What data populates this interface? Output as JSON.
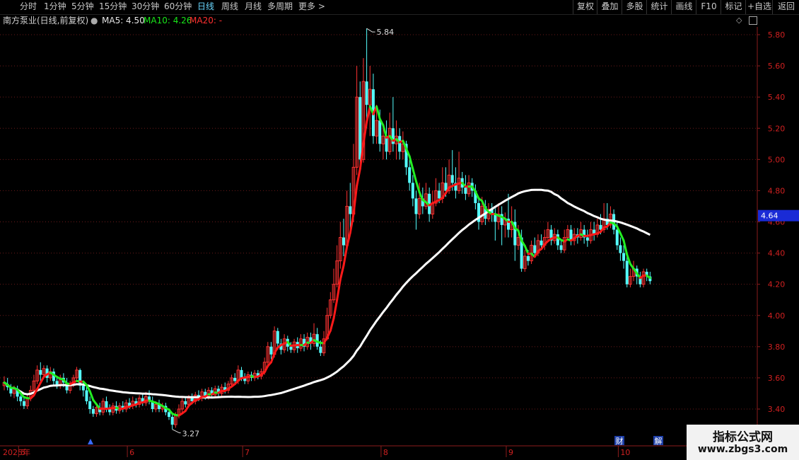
{
  "toolbar": {
    "periods": [
      {
        "label": "分时"
      },
      {
        "label": "1分钟"
      },
      {
        "label": "5分钟"
      },
      {
        "label": "15分钟"
      },
      {
        "label": "30分钟"
      },
      {
        "label": "60分钟"
      },
      {
        "label": "日线",
        "active": true
      },
      {
        "label": "周线"
      },
      {
        "label": "月线"
      },
      {
        "label": "多周期"
      },
      {
        "label": "更多 >"
      }
    ],
    "actions": [
      {
        "label": "复权"
      },
      {
        "label": "叠加"
      },
      {
        "label": "多股"
      },
      {
        "label": "统计"
      },
      {
        "label": "画线"
      },
      {
        "label": "F10"
      },
      {
        "label": "标记"
      },
      {
        "label": "+自选"
      },
      {
        "label": "返回"
      }
    ]
  },
  "info": {
    "stock": "南方泵业(日线,前复权)",
    "ma5_label": "MA5: 4.50",
    "ma10_label": "MA10: 4.26",
    "ma20_label": "MA20: -"
  },
  "chart_data": {
    "type": "candlestick",
    "ylim": [
      3.3,
      5.9
    ],
    "y_ticks": [
      "5.80",
      "5.60",
      "5.40",
      "5.20",
      "5.00",
      "4.80",
      "4.60",
      "4.40",
      "4.20",
      "4.00",
      "3.80",
      "3.60",
      "3.40"
    ],
    "x_labels": [
      {
        "label": "2025年",
        "i": 0
      },
      {
        "label": "5",
        "i": 5
      },
      {
        "label": "6",
        "i": 38
      },
      {
        "label": "7",
        "i": 73
      },
      {
        "label": "8",
        "i": 115
      },
      {
        "label": "9",
        "i": 153
      },
      {
        "label": "10",
        "i": 187
      },
      {
        "label": "11",
        "i": 215
      }
    ],
    "current_price": "4.64",
    "max_annotation": "5.84",
    "min_annotation": "3.27",
    "event_markers": [
      "财",
      "解"
    ],
    "candles": [
      [
        3.55,
        3.57,
        3.52,
        3.61
      ],
      [
        3.56,
        3.54,
        3.52,
        3.6
      ],
      [
        3.54,
        3.5,
        3.48,
        3.56
      ],
      [
        3.5,
        3.53,
        3.47,
        3.55
      ],
      [
        3.53,
        3.48,
        3.45,
        3.55
      ],
      [
        3.48,
        3.45,
        3.42,
        3.51
      ],
      [
        3.45,
        3.42,
        3.4,
        3.48
      ],
      [
        3.42,
        3.47,
        3.4,
        3.49
      ],
      [
        3.47,
        3.52,
        3.45,
        3.55
      ],
      [
        3.52,
        3.58,
        3.5,
        3.62
      ],
      [
        3.58,
        3.65,
        3.56,
        3.68
      ],
      [
        3.65,
        3.62,
        3.58,
        3.7
      ],
      [
        3.62,
        3.66,
        3.6,
        3.68
      ],
      [
        3.66,
        3.6,
        3.57,
        3.68
      ],
      [
        3.6,
        3.64,
        3.58,
        3.67
      ],
      [
        3.64,
        3.58,
        3.55,
        3.66
      ],
      [
        3.58,
        3.55,
        3.53,
        3.61
      ],
      [
        3.55,
        3.6,
        3.53,
        3.62
      ],
      [
        3.6,
        3.57,
        3.54,
        3.63
      ],
      [
        3.57,
        3.52,
        3.5,
        3.6
      ],
      [
        3.52,
        3.56,
        3.5,
        3.58
      ],
      [
        3.56,
        3.6,
        3.54,
        3.62
      ],
      [
        3.6,
        3.65,
        3.58,
        3.67
      ],
      [
        3.65,
        3.55,
        3.52,
        3.66
      ],
      [
        3.55,
        3.52,
        3.48,
        3.57
      ],
      [
        3.52,
        3.45,
        3.43,
        3.55
      ],
      [
        3.45,
        3.4,
        3.37,
        3.48
      ],
      [
        3.4,
        3.37,
        3.35,
        3.42
      ],
      [
        3.37,
        3.41,
        3.35,
        3.44
      ],
      [
        3.41,
        3.38,
        3.36,
        3.44
      ],
      [
        3.38,
        3.45,
        3.36,
        3.47
      ],
      [
        3.45,
        3.4,
        3.38,
        3.48
      ],
      [
        3.4,
        3.38,
        3.36,
        3.43
      ],
      [
        3.38,
        3.42,
        3.36,
        3.44
      ],
      [
        3.42,
        3.39,
        3.37,
        3.45
      ],
      [
        3.39,
        3.42,
        3.37,
        3.44
      ],
      [
        3.42,
        3.4,
        3.38,
        3.45
      ],
      [
        3.4,
        3.44,
        3.38,
        3.46
      ],
      [
        3.44,
        3.42,
        3.4,
        3.47
      ],
      [
        3.42,
        3.45,
        3.4,
        3.48
      ],
      [
        3.45,
        3.43,
        3.41,
        3.47
      ],
      [
        3.43,
        3.47,
        3.41,
        3.49
      ],
      [
        3.47,
        3.44,
        3.42,
        3.5
      ],
      [
        3.44,
        3.48,
        3.42,
        3.51
      ],
      [
        3.48,
        3.45,
        3.43,
        3.52
      ],
      [
        3.45,
        3.4,
        3.38,
        3.48
      ],
      [
        3.4,
        3.43,
        3.38,
        3.45
      ],
      [
        3.43,
        3.4,
        3.38,
        3.46
      ],
      [
        3.4,
        3.42,
        3.38,
        3.44
      ],
      [
        3.42,
        3.38,
        3.36,
        3.44
      ],
      [
        3.38,
        3.35,
        3.33,
        3.4
      ],
      [
        3.35,
        3.3,
        3.27,
        3.37
      ],
      [
        3.3,
        3.36,
        3.28,
        3.38
      ],
      [
        3.36,
        3.4,
        3.34,
        3.43
      ],
      [
        3.4,
        3.45,
        3.38,
        3.47
      ],
      [
        3.45,
        3.43,
        3.41,
        3.48
      ],
      [
        3.43,
        3.47,
        3.41,
        3.49
      ],
      [
        3.47,
        3.45,
        3.43,
        3.5
      ],
      [
        3.45,
        3.49,
        3.43,
        3.51
      ],
      [
        3.49,
        3.47,
        3.45,
        3.52
      ],
      [
        3.47,
        3.51,
        3.45,
        3.53
      ],
      [
        3.51,
        3.48,
        3.46,
        3.53
      ],
      [
        3.48,
        3.52,
        3.46,
        3.54
      ],
      [
        3.52,
        3.49,
        3.47,
        3.54
      ],
      [
        3.49,
        3.53,
        3.47,
        3.55
      ],
      [
        3.53,
        3.5,
        3.48,
        3.55
      ],
      [
        3.5,
        3.54,
        3.48,
        3.56
      ],
      [
        3.54,
        3.52,
        3.5,
        3.57
      ],
      [
        3.52,
        3.56,
        3.5,
        3.58
      ],
      [
        3.56,
        3.6,
        3.54,
        3.62
      ],
      [
        3.6,
        3.58,
        3.56,
        3.63
      ],
      [
        3.58,
        3.65,
        3.56,
        3.68
      ],
      [
        3.65,
        3.6,
        3.58,
        3.67
      ],
      [
        3.6,
        3.58,
        3.56,
        3.63
      ],
      [
        3.58,
        3.62,
        3.56,
        3.64
      ],
      [
        3.62,
        3.6,
        3.58,
        3.64
      ],
      [
        3.6,
        3.63,
        3.58,
        3.65
      ],
      [
        3.63,
        3.61,
        3.59,
        3.65
      ],
      [
        3.61,
        3.64,
        3.59,
        3.66
      ],
      [
        3.64,
        3.7,
        3.62,
        3.73
      ],
      [
        3.7,
        3.8,
        3.68,
        3.83
      ],
      [
        3.8,
        3.75,
        3.72,
        3.83
      ],
      [
        3.75,
        3.9,
        3.73,
        3.93
      ],
      [
        3.9,
        3.82,
        3.78,
        3.92
      ],
      [
        3.82,
        3.78,
        3.75,
        3.85
      ],
      [
        3.78,
        3.85,
        3.76,
        3.88
      ],
      [
        3.85,
        3.8,
        3.77,
        3.87
      ],
      [
        3.8,
        3.78,
        3.76,
        3.83
      ],
      [
        3.78,
        3.83,
        3.76,
        3.85
      ],
      [
        3.83,
        3.79,
        3.76,
        3.86
      ],
      [
        3.79,
        3.85,
        3.77,
        3.88
      ],
      [
        3.85,
        3.8,
        3.77,
        3.88
      ],
      [
        3.8,
        3.86,
        3.78,
        3.89
      ],
      [
        3.86,
        3.82,
        3.78,
        3.89
      ],
      [
        3.82,
        3.88,
        3.8,
        3.95
      ],
      [
        3.88,
        3.8,
        3.78,
        3.92
      ],
      [
        3.8,
        3.76,
        3.74,
        3.84
      ],
      [
        3.76,
        3.85,
        3.74,
        3.9
      ],
      [
        3.85,
        4.0,
        3.84,
        4.05
      ],
      [
        4.0,
        4.1,
        3.98,
        4.15
      ],
      [
        4.1,
        4.2,
        4.08,
        4.3
      ],
      [
        4.2,
        4.35,
        4.18,
        4.45
      ],
      [
        4.35,
        4.5,
        4.3,
        4.6
      ],
      [
        4.5,
        4.45,
        4.38,
        4.62
      ],
      [
        4.45,
        4.7,
        4.42,
        4.8
      ],
      [
        4.7,
        4.65,
        4.55,
        4.85
      ],
      [
        4.65,
        4.95,
        4.6,
        5.1
      ],
      [
        4.95,
        5.4,
        4.9,
        5.6
      ],
      [
        5.4,
        5.0,
        4.95,
        5.5
      ],
      [
        5.0,
        5.5,
        4.98,
        5.65
      ],
      [
        5.5,
        5.35,
        5.2,
        5.84
      ],
      [
        5.35,
        5.45,
        5.15,
        5.6
      ],
      [
        5.45,
        5.15,
        5.1,
        5.55
      ],
      [
        5.15,
        5.25,
        5.1,
        5.35
      ],
      [
        5.25,
        5.1,
        5.05,
        5.32
      ],
      [
        5.1,
        5.15,
        5.0,
        5.2
      ],
      [
        5.15,
        5.05,
        5.0,
        5.25
      ],
      [
        5.05,
        5.2,
        5.03,
        5.3
      ],
      [
        5.2,
        5.1,
        5.05,
        5.4
      ],
      [
        5.1,
        5.15,
        5.0,
        5.25
      ],
      [
        5.15,
        5.05,
        5.0,
        5.2
      ],
      [
        5.05,
        5.1,
        5.0,
        5.18
      ],
      [
        5.1,
        4.95,
        4.9,
        5.12
      ],
      [
        4.95,
        4.85,
        4.8,
        5.0
      ],
      [
        4.85,
        4.75,
        4.7,
        4.9
      ],
      [
        4.75,
        4.65,
        4.55,
        4.8
      ],
      [
        4.65,
        4.75,
        4.62,
        4.85
      ],
      [
        4.75,
        4.7,
        4.65,
        4.82
      ],
      [
        4.7,
        4.78,
        4.68,
        4.85
      ],
      [
        4.78,
        4.65,
        4.6,
        4.82
      ],
      [
        4.65,
        4.72,
        4.62,
        4.8
      ],
      [
        4.72,
        4.8,
        4.7,
        4.88
      ],
      [
        4.8,
        4.75,
        4.72,
        4.85
      ],
      [
        4.75,
        4.85,
        4.72,
        4.95
      ],
      [
        4.85,
        4.8,
        4.76,
        4.95
      ],
      [
        4.8,
        4.9,
        4.78,
        5.0
      ],
      [
        4.9,
        4.85,
        4.8,
        5.06
      ],
      [
        4.85,
        4.8,
        4.75,
        4.95
      ],
      [
        4.8,
        4.88,
        4.78,
        5.05
      ],
      [
        4.88,
        4.82,
        4.78,
        4.92
      ],
      [
        4.82,
        4.78,
        4.74,
        4.9
      ],
      [
        4.78,
        4.85,
        4.76,
        4.9
      ],
      [
        4.85,
        4.8,
        4.76,
        4.88
      ],
      [
        4.8,
        4.72,
        4.68,
        4.84
      ],
      [
        4.72,
        4.6,
        4.55,
        4.76
      ],
      [
        4.6,
        4.7,
        4.58,
        4.76
      ],
      [
        4.7,
        4.62,
        4.58,
        4.74
      ],
      [
        4.62,
        4.68,
        4.6,
        4.72
      ],
      [
        4.68,
        4.65,
        4.6,
        4.72
      ],
      [
        4.65,
        4.6,
        4.48,
        4.7
      ],
      [
        4.6,
        4.65,
        4.55,
        4.72
      ],
      [
        4.65,
        4.58,
        4.45,
        4.7
      ],
      [
        4.58,
        4.62,
        4.5,
        4.66
      ],
      [
        4.62,
        4.55,
        4.5,
        4.78
      ],
      [
        4.55,
        4.6,
        4.5,
        4.7
      ],
      [
        4.6,
        4.45,
        4.35,
        4.68
      ],
      [
        4.45,
        4.5,
        4.42,
        4.58
      ],
      [
        4.5,
        4.3,
        4.28,
        4.55
      ],
      [
        4.3,
        4.38,
        4.28,
        4.42
      ],
      [
        4.38,
        4.35,
        4.32,
        4.42
      ],
      [
        4.35,
        4.45,
        4.33,
        4.48
      ],
      [
        4.45,
        4.4,
        4.38,
        4.5
      ],
      [
        4.4,
        4.48,
        4.38,
        4.52
      ],
      [
        4.48,
        4.45,
        4.42,
        4.52
      ],
      [
        4.45,
        4.5,
        4.42,
        4.55
      ],
      [
        4.5,
        4.55,
        4.48,
        4.6
      ],
      [
        4.55,
        4.48,
        4.45,
        4.58
      ],
      [
        4.48,
        4.52,
        4.46,
        4.56
      ],
      [
        4.52,
        4.45,
        4.42,
        4.55
      ],
      [
        4.45,
        4.42,
        4.4,
        4.48
      ],
      [
        4.42,
        4.5,
        4.4,
        4.55
      ],
      [
        4.5,
        4.55,
        4.48,
        4.58
      ],
      [
        4.55,
        4.48,
        4.45,
        4.58
      ],
      [
        4.48,
        4.52,
        4.45,
        4.56
      ],
      [
        4.52,
        4.5,
        4.46,
        4.56
      ],
      [
        4.5,
        4.55,
        4.48,
        4.6
      ],
      [
        4.55,
        4.5,
        4.46,
        4.58
      ],
      [
        4.5,
        4.48,
        4.44,
        4.55
      ],
      [
        4.48,
        4.55,
        4.46,
        4.6
      ],
      [
        4.55,
        4.52,
        4.48,
        4.6
      ],
      [
        4.52,
        4.58,
        4.5,
        4.62
      ],
      [
        4.58,
        4.55,
        4.52,
        4.65
      ],
      [
        4.55,
        4.62,
        4.53,
        4.72
      ],
      [
        4.62,
        4.58,
        4.55,
        4.72
      ],
      [
        4.58,
        4.65,
        4.56,
        4.7
      ],
      [
        4.65,
        4.55,
        4.52,
        4.68
      ],
      [
        4.55,
        4.45,
        4.42,
        4.6
      ],
      [
        4.45,
        4.4,
        4.35,
        4.5
      ],
      [
        4.4,
        4.35,
        4.3,
        4.45
      ],
      [
        4.35,
        4.2,
        4.18,
        4.38
      ],
      [
        4.2,
        4.25,
        4.18,
        4.3
      ],
      [
        4.25,
        4.3,
        4.22,
        4.35
      ],
      [
        4.3,
        4.25,
        4.2,
        4.32
      ],
      [
        4.25,
        4.2,
        4.18,
        4.28
      ],
      [
        4.2,
        4.28,
        4.18,
        4.3
      ],
      [
        4.28,
        4.25,
        4.22,
        4.3
      ],
      [
        4.25,
        4.22,
        4.2,
        4.28
      ]
    ]
  },
  "watermark": {
    "line1": "指标公式网",
    "line2": "www.zbgs3.com"
  }
}
